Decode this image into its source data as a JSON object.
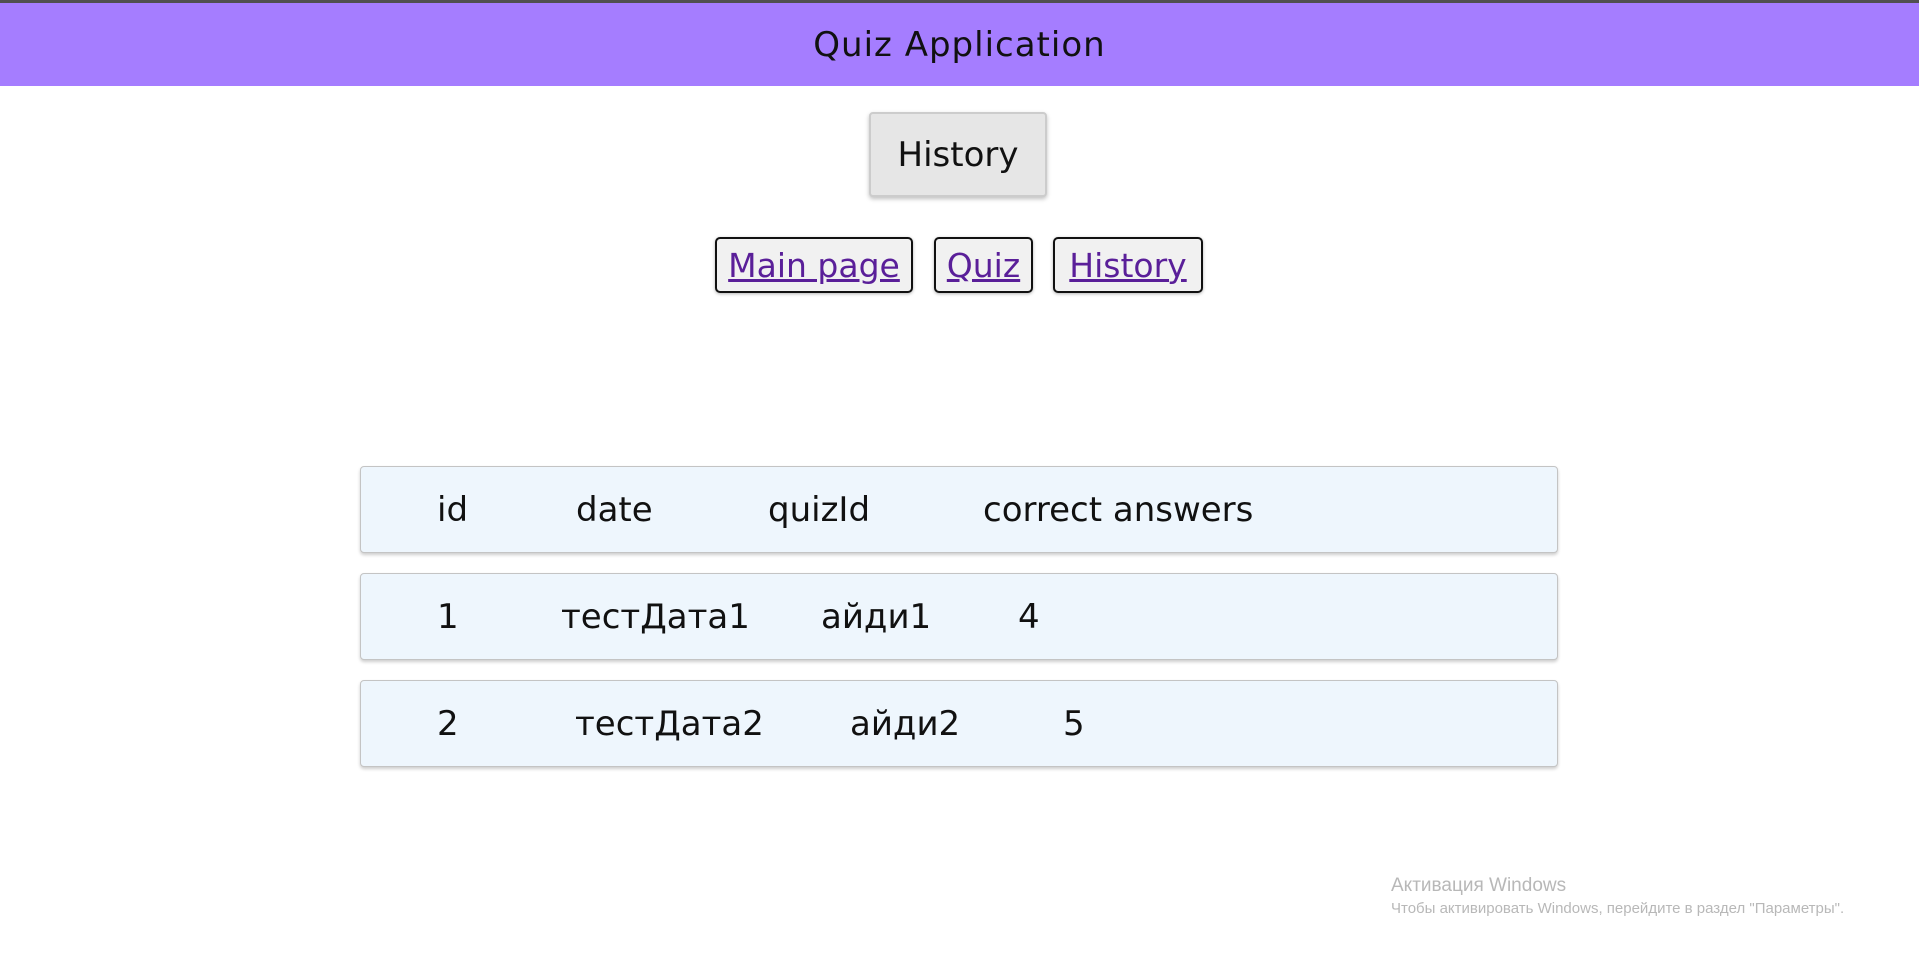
{
  "header": {
    "title": "Quiz Application",
    "color": "#a57dff"
  },
  "page_title": "History",
  "nav": {
    "main_page": "Main page",
    "quiz": "Quiz",
    "history": "History",
    "link_color": "#5a1f99"
  },
  "table": {
    "columns": [
      "id",
      "date",
      "quizId",
      "correct answers"
    ],
    "rows": [
      [
        "1",
        "тестДата1",
        "айди1",
        "4"
      ],
      [
        "2",
        "тестДата2",
        "айди2",
        "5"
      ]
    ]
  },
  "watermark": {
    "title": "Активация Windows",
    "text": "Чтобы активировать Windows, перейдите в раздел \"Параметры\"."
  }
}
